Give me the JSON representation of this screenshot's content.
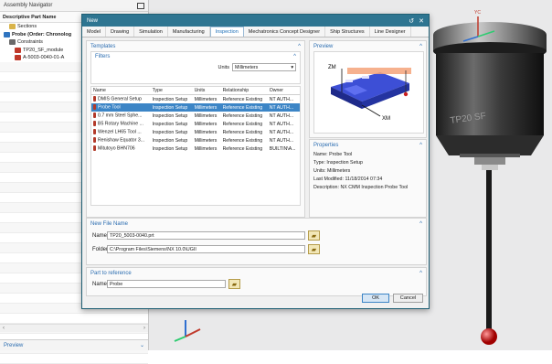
{
  "navigator": {
    "title": "Assembly Navigator",
    "column_header": "Descriptive Part Name",
    "tree": [
      {
        "label": "Sections",
        "indent": 1,
        "icon": "sections-folder-icon",
        "color": "#d9b44a"
      },
      {
        "label": "Probe (Order: Chronolog",
        "indent": 0,
        "icon": "assembly-icon",
        "color": "#2f74c0",
        "bold": true
      },
      {
        "label": "Constraints",
        "indent": 1,
        "icon": "constraints-icon",
        "color": "#6a6a6a"
      },
      {
        "label": "TP20_SF_module",
        "indent": 2,
        "icon": "component-icon",
        "color": "#c0392b"
      },
      {
        "label": "A-5003-0040-01-A",
        "indent": 2,
        "icon": "component-icon",
        "color": "#c0392b"
      }
    ],
    "preview_label": "Preview"
  },
  "dialog": {
    "title": "New",
    "tabs": [
      "Model",
      "Drawing",
      "Simulation",
      "Manufacturing",
      "Inspection",
      "Mechatronics Concept Designer",
      "Ship Structures",
      "Line Designer"
    ],
    "active_tab": "Inspection",
    "templates": {
      "heading": "Templates",
      "filters_label": "Filters",
      "units_label": "Units",
      "units_value": "Millimeters",
      "columns": [
        "Name",
        "Type",
        "Units",
        "Relationship",
        "Owner"
      ],
      "rows": [
        {
          "name": "DMIS General Setup",
          "type": "Inspection Setup",
          "units": "Millimeters",
          "relationship": "Reference Existing",
          "owner": "NT AUTH...",
          "selected": false
        },
        {
          "name": "Probe Tool",
          "type": "Inspection Setup",
          "units": "Millimeters",
          "relationship": "Reference Existing",
          "owner": "NT AUTH...",
          "selected": true
        },
        {
          "name": "0.7 mm Steel Sphe...",
          "type": "Inspection Setup",
          "units": "Millimeters",
          "relationship": "Reference Existing",
          "owner": "NT AUTH...",
          "selected": false
        },
        {
          "name": "B5 Rotary Machine ...",
          "type": "Inspection Setup",
          "units": "Millimeters",
          "relationship": "Reference Existing",
          "owner": "NT AUTH...",
          "selected": false
        },
        {
          "name": "Wenzel LH65 Tool ...",
          "type": "Inspection Setup",
          "units": "Millimeters",
          "relationship": "Reference Existing",
          "owner": "NT AUTH...",
          "selected": false
        },
        {
          "name": "Renishaw Equator 3...",
          "type": "Inspection Setup",
          "units": "Millimeters",
          "relationship": "Reference Existing",
          "owner": "NT AUTH...",
          "selected": false
        },
        {
          "name": "Mitutoyo BHN706",
          "type": "Inspection Setup",
          "units": "Millimeters",
          "relationship": "Reference Existing",
          "owner": "BUILTIN\\A...",
          "selected": false
        }
      ]
    },
    "preview": {
      "heading": "Preview",
      "axis_zm": "ZM",
      "axis_xm": "XM"
    },
    "properties": {
      "heading": "Properties",
      "lines": [
        "Name: Probe Tool",
        "Type: Inspection Setup",
        "Units: Millimeters",
        "Last Modified: 11/18/2014 07:34",
        "Description: NX CMM Inspection Probe Tool"
      ]
    },
    "new_file": {
      "heading": "New File Name",
      "name_label": "Name",
      "name_value": "TP20_5003-0040.prt",
      "folder_label": "Folder",
      "folder_value": "C:\\Program Files\\Siemens\\NX 10.0\\UGII"
    },
    "part_ref": {
      "heading": "Part to reference",
      "name_label": "Name",
      "name_value": "Probe"
    },
    "ok_label": "OK",
    "cancel_label": "Cancel"
  },
  "viewport": {
    "axis_yc": "YC"
  }
}
